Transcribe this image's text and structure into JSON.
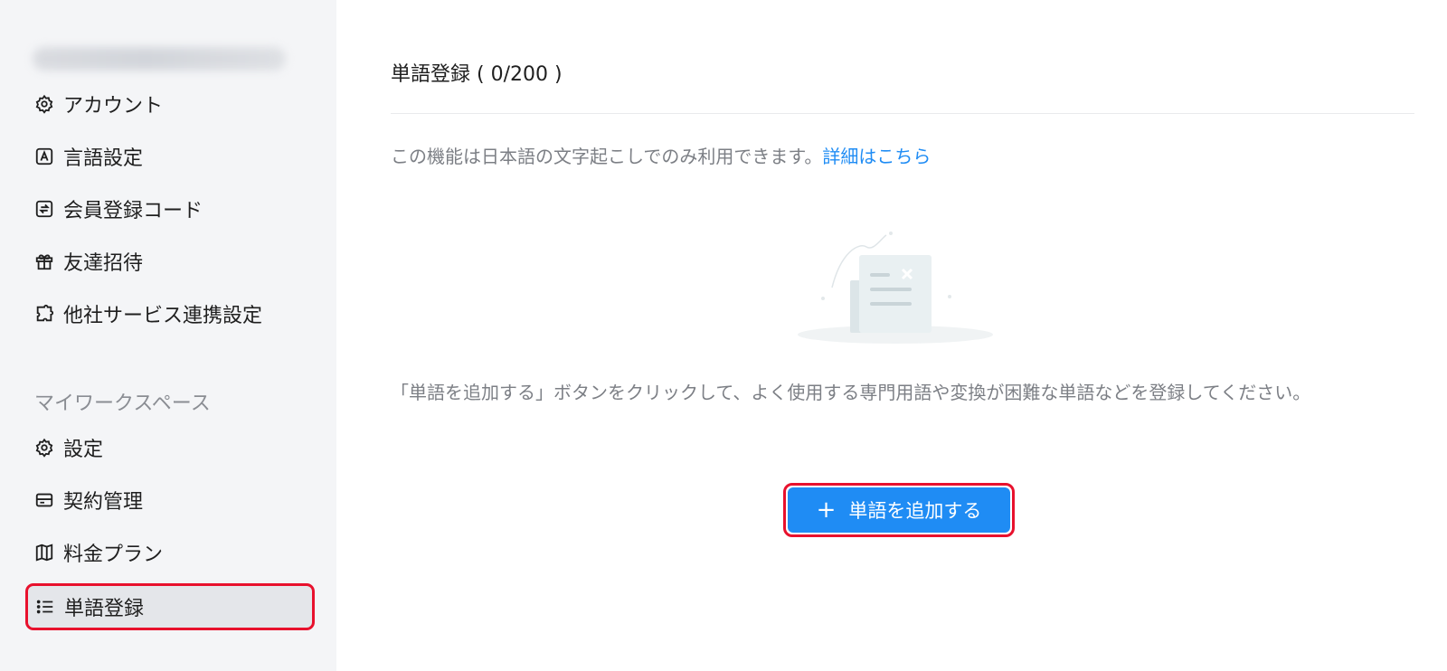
{
  "sidebar": {
    "account_items": [
      {
        "label": "アカウント",
        "icon": "gear-icon"
      },
      {
        "label": "言語設定",
        "icon": "language-icon"
      },
      {
        "label": "会員登録コード",
        "icon": "code-exchange-icon"
      },
      {
        "label": "友達招待",
        "icon": "gift-icon"
      },
      {
        "label": "他社サービス連携設定",
        "icon": "integration-icon"
      }
    ],
    "workspace_label": "マイワークスペース",
    "workspace_items": [
      {
        "label": "設定",
        "icon": "gear-icon"
      },
      {
        "label": "契約管理",
        "icon": "contract-icon"
      },
      {
        "label": "料金プラン",
        "icon": "map-icon"
      },
      {
        "label": "単語登録",
        "icon": "list-icon",
        "active": true
      }
    ]
  },
  "main": {
    "title": "単語登録 ( 0/200 )",
    "notice_text": "この機能は日本語の文字起こしでのみ利用できます。",
    "notice_link": "詳細はこちら",
    "description": "「単語を追加する」ボタンをクリックして、よく使用する専門用語や変換が困難な単語などを登録してください。",
    "add_button": {
      "icon": "+",
      "label": "単語を追加する"
    }
  },
  "colors": {
    "accent": "#1f8cf4",
    "highlight": "#e8112d",
    "sidebar_bg": "#f4f5f7"
  }
}
